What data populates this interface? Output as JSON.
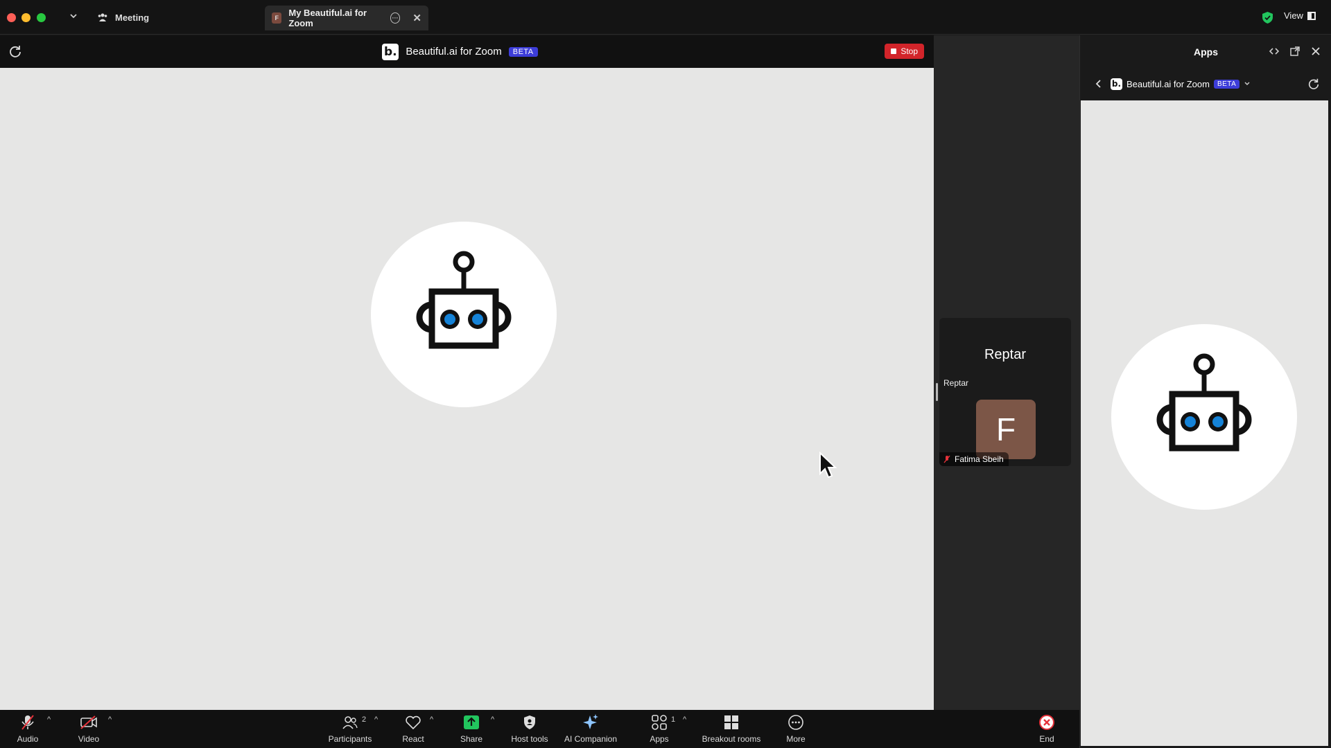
{
  "titlebar": {
    "meeting_label": "Meeting",
    "tab_label": "My Beautiful.ai for Zoom",
    "tab_favicon": "F",
    "view_label": "View"
  },
  "share_header": {
    "title": "Beautiful.ai for Zoom",
    "beta": "BETA",
    "stop_label": "Stop"
  },
  "gallery": {
    "participant_big": "Reptar",
    "participant_small": "Reptar",
    "avatar_initial": "F",
    "name_label": "Fatima Sbeih"
  },
  "apps_panel": {
    "title": "Apps",
    "app_name": "Beautiful.ai for Zoom",
    "beta": "BETA"
  },
  "toolbar": {
    "audio": "Audio",
    "video": "Video",
    "participants": "Participants",
    "participants_count": "2",
    "react": "React",
    "share": "Share",
    "host_tools": "Host tools",
    "ai_companion": "AI Companion",
    "apps": "Apps",
    "apps_count": "1",
    "breakout": "Breakout rooms",
    "more": "More",
    "end": "End"
  },
  "colors": {
    "stop": "#d2242a",
    "beta": "#3d3dd9",
    "share_green": "#22c55e",
    "robot_eye": "#1583d8",
    "end_red": "#e5323a"
  }
}
